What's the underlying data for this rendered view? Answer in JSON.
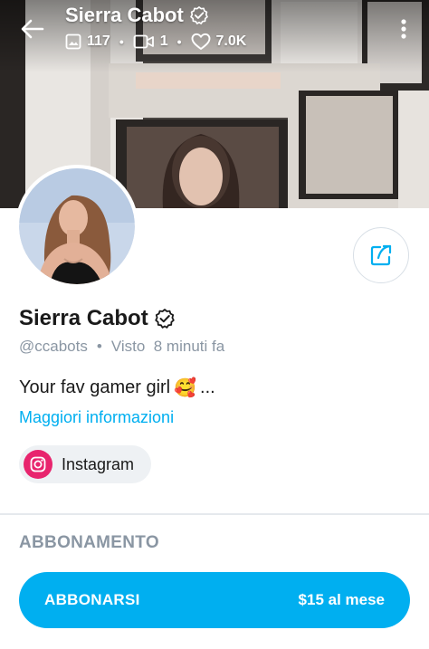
{
  "header": {
    "title": "Sierra Cabot",
    "stats": {
      "photos": "117",
      "videos": "1",
      "likes": "7.0K"
    }
  },
  "profile": {
    "name": "Sierra Cabot",
    "handle": "@ccabots",
    "separator": "•",
    "last_seen": "Visto  8 minuti fa",
    "bio": "Your fav gamer girl",
    "bio_emoji": "🥰",
    "bio_ellipsis": "...",
    "more_info": "Maggiori informazioni",
    "social": {
      "label": "Instagram"
    }
  },
  "subscription": {
    "section_title": "ABBONAMENTO",
    "button_label": "ABBONARSI",
    "price": "$15 al mese"
  },
  "colors": {
    "accent": "#00aff0",
    "muted": "#8a96a3",
    "instagram": "#e8256e"
  },
  "icons": {
    "back": "arrow-left-icon",
    "verified": "verified-badge-icon",
    "photos": "image-icon",
    "videos": "video-icon",
    "likes": "heart-icon",
    "more": "more-vertical-icon",
    "share": "share-icon",
    "instagram": "instagram-icon"
  }
}
